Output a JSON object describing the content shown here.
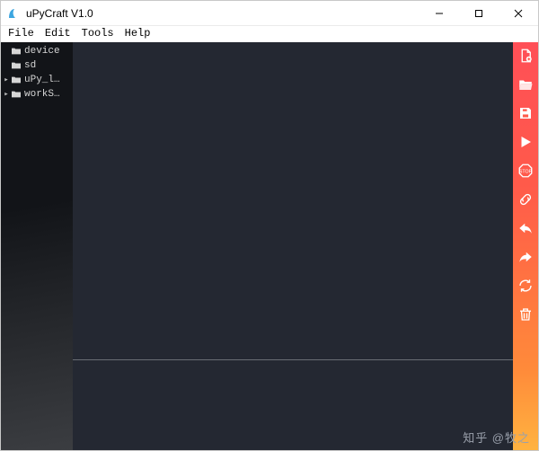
{
  "window": {
    "title": "uPyCraft V1.0"
  },
  "menu": {
    "items": [
      "File",
      "Edit",
      "Tools",
      "Help"
    ]
  },
  "sidebar": {
    "items": [
      {
        "label": "device",
        "expandable": false
      },
      {
        "label": "sd",
        "expandable": false
      },
      {
        "label": "uPy_l…",
        "expandable": true
      },
      {
        "label": "workS…",
        "expandable": true
      }
    ]
  },
  "toolbar": {
    "buttons": [
      {
        "name": "new-file",
        "icon": "file-plus"
      },
      {
        "name": "open-file",
        "icon": "folder-open"
      },
      {
        "name": "save-file",
        "icon": "save"
      },
      {
        "name": "download-run",
        "icon": "play"
      },
      {
        "name": "stop",
        "icon": "stop"
      },
      {
        "name": "connect",
        "icon": "link"
      },
      {
        "name": "undo",
        "icon": "undo"
      },
      {
        "name": "redo",
        "icon": "redo"
      },
      {
        "name": "sync",
        "icon": "sync"
      },
      {
        "name": "clear",
        "icon": "trash"
      }
    ]
  },
  "watermark": "知乎 @牧之"
}
